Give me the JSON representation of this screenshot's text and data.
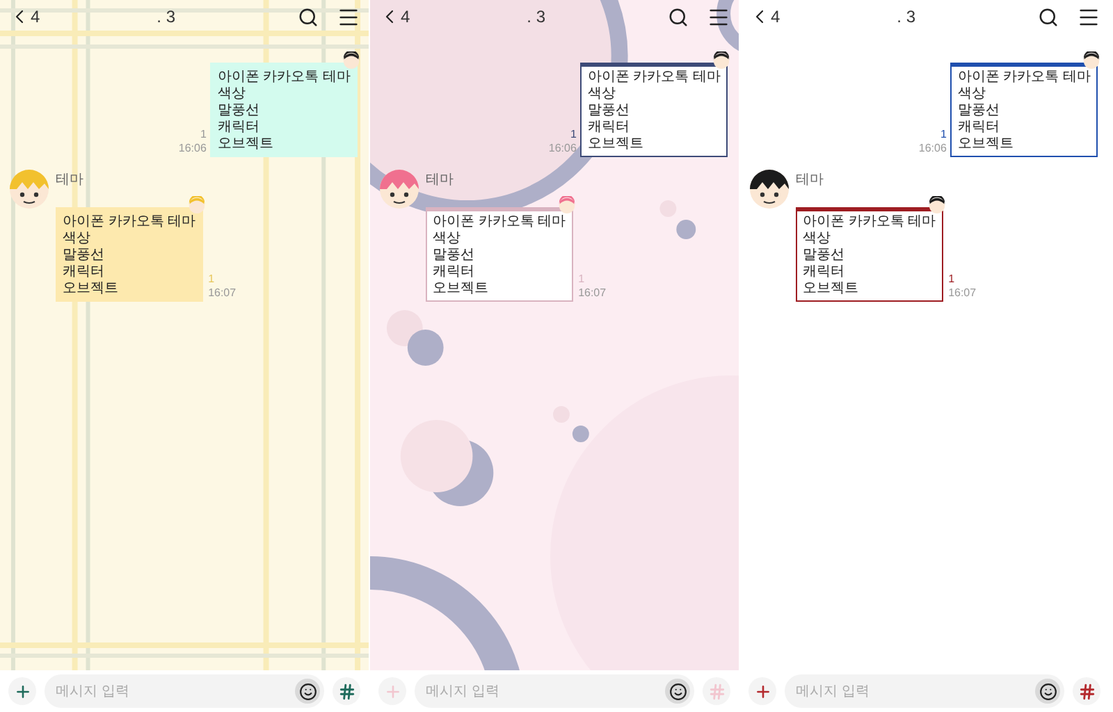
{
  "panels": [
    {
      "kind": "plaid",
      "header": {
        "back_count": "4",
        "title": ". 3"
      },
      "sent": {
        "lines": [
          "아이폰 카카오톡 테마",
          "색상",
          "말풍선",
          "캐릭터",
          "오브젝트"
        ],
        "color": "#d3fbee",
        "unread": "1",
        "time": "16:06"
      },
      "received": {
        "sender": "테마",
        "lines": [
          "아이폰 카카오톡 테마",
          "색상",
          "말풍선",
          "캐릭터",
          "오브젝트"
        ],
        "color": "#fde9ae",
        "unread": "1",
        "time": "16:07"
      },
      "composer": {
        "placeholder": "메시지 입력"
      }
    },
    {
      "kind": "circles",
      "header": {
        "back_count": "4",
        "title": ". 3"
      },
      "sent": {
        "lines": [
          "아이폰 카카오톡 테마",
          "색상",
          "말풍선",
          "캐릭터",
          "오브젝트"
        ],
        "color": "#3d4b78",
        "unread": "1",
        "time": "16:06"
      },
      "received": {
        "sender": "테마",
        "lines": [
          "아이폰 카카오톡 테마",
          "색상",
          "말풍선",
          "캐릭터",
          "오브젝트"
        ],
        "color": "#d9b3c0",
        "unread": "1",
        "time": "16:07"
      },
      "composer": {
        "placeholder": "메시지 입력"
      }
    },
    {
      "kind": "plain",
      "header": {
        "back_count": "4",
        "title": ". 3"
      },
      "sent": {
        "lines": [
          "아이폰 카카오톡 테마",
          "색상",
          "말풍선",
          "캐릭터",
          "오브젝트"
        ],
        "color": "#1f4fae",
        "unread": "1",
        "time": "16:06"
      },
      "received": {
        "sender": "테마",
        "lines": [
          "아이폰 카카오톡 테마",
          "색상",
          "말풍선",
          "캐릭터",
          "오브젝트"
        ],
        "color": "#9e1d22",
        "unread": "1",
        "time": "16:07"
      },
      "composer": {
        "placeholder": "메시지 입력"
      }
    }
  ]
}
